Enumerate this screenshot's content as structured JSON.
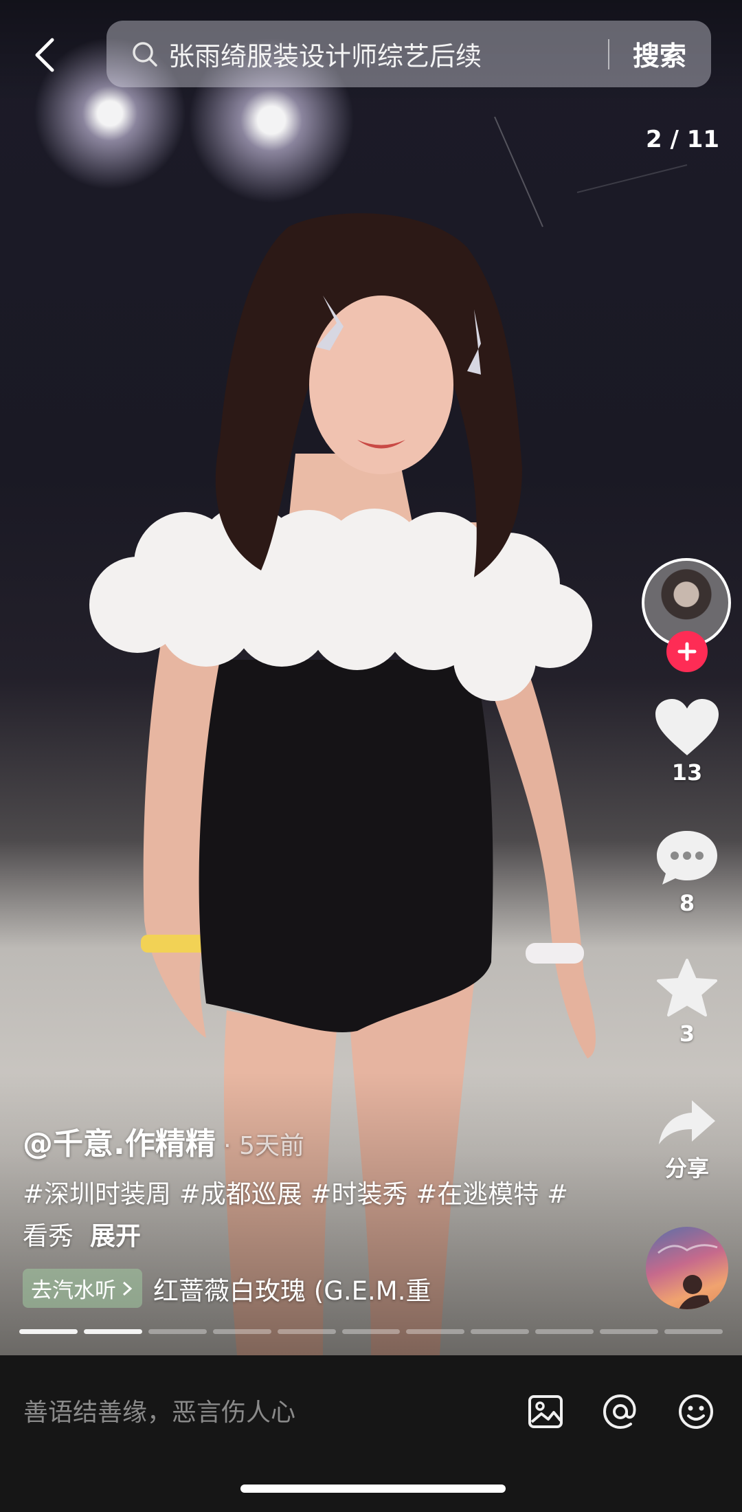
{
  "search": {
    "query": "张雨绮服装设计师综艺后续",
    "button": "搜索"
  },
  "counter": "2 / 11",
  "rail": {
    "likes": "13",
    "comments": "8",
    "favorites": "3",
    "share_label": "分享"
  },
  "post": {
    "author": "@千意.作精精",
    "time": "5天前",
    "tags": "#深圳时装周 #成都巡展 #时装秀 #在逃模特 #看秀",
    "expand": "展开",
    "music_chip": "去汽水听",
    "music_name": "红蔷薇白玫瑰 (G.E.M.重"
  },
  "progress": {
    "total": 11,
    "current": 2
  },
  "comment": {
    "placeholder": "善语结善缘，恶言伤人心"
  },
  "colors": {
    "follow": "#fe2c55",
    "bar": "#161616"
  }
}
